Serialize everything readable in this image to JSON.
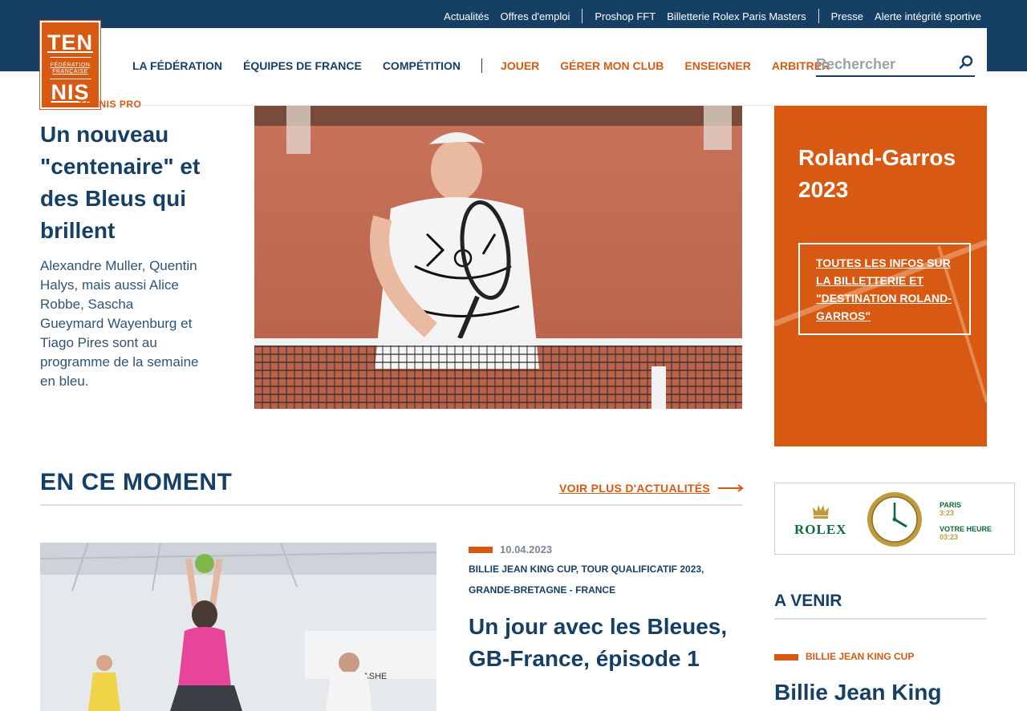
{
  "utility_nav": {
    "group1": [
      "Actualités",
      "Offres d'emploi"
    ],
    "group2": [
      "Proshop FFT",
      "Billetterie Rolex Paris Masters"
    ],
    "group3": [
      "Presse",
      "Alerte intégrité sportive"
    ]
  },
  "logo": {
    "line1": "TEN",
    "small1": "FÉDÉRATION",
    "small2": "FRANÇAISE",
    "line2": "NIS"
  },
  "main_nav": {
    "primary": [
      "LA FÉDÉRATION",
      "ÉQUIPES DE FRANCE",
      "COMPÉTITION"
    ],
    "secondary": [
      "JOUER",
      "GÉRER MON CLUB",
      "ENSEIGNER",
      "ARBITRER"
    ]
  },
  "search": {
    "placeholder": "Rechercher"
  },
  "hero": {
    "category": "TENNIS PRO",
    "title": "Un nouveau \"centenaire\" et des Bleus qui brillent",
    "description": "Alexandre Muller, Quentin Halys, mais aussi Alice Robbe, Sascha Gueymard Wayenburg et Tiago Pires sont au programme de la semaine en bleu."
  },
  "promo": {
    "title": "Roland-Garros 2023",
    "button": "TOUTES LES INFOS SUR LA BILLETTERIE ET \"DESTINATION ROLAND-GARROS\""
  },
  "section": {
    "title": "EN CE MOMENT",
    "more_link": "VOIR PLUS D'ACTUALITÉS"
  },
  "news": {
    "date": "10.04.2023",
    "tags": "BILLIE JEAN KING CUP, TOUR QUALIFICATIF 2023, GRANDE-BRETAGNE - FRANCE",
    "title": "Un jour avec les Bleues, GB-France, épisode 1",
    "photo_caption": "Arthur ASHE"
  },
  "rolex_ad": {
    "brand": "ROLEX",
    "city": "PARIS",
    "city_time": "3:23",
    "local_label": "VOTRE HEURE",
    "local_time": "03:23"
  },
  "upcoming": {
    "title": "A VENIR",
    "tag": "BILLIE JEAN KING CUP",
    "event": "Billie Jean King"
  },
  "colors": {
    "navy": "#163f66",
    "orange": "#d85a12",
    "rolex_green": "#0b6b3a"
  }
}
